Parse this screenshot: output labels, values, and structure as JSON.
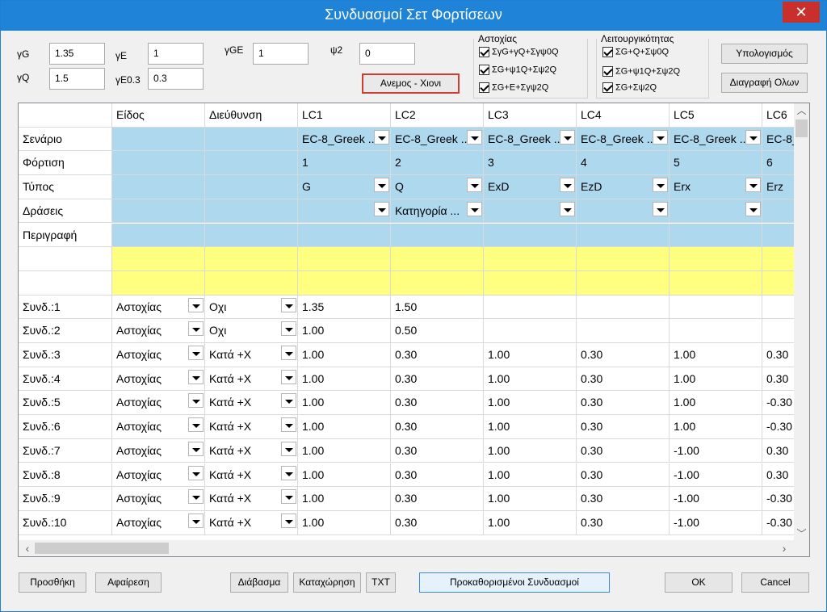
{
  "window": {
    "title": "Συνδυασμοί Σετ Φορτίσεων",
    "close": "✕"
  },
  "factors": {
    "gG": {
      "label": "γG",
      "value": "1.35"
    },
    "gQ": {
      "label": "γQ",
      "value": "1.5"
    },
    "gE": {
      "label": "γE",
      "value": "1"
    },
    "gE03": {
      "label": "γE0.3",
      "value": "0.3"
    },
    "gGE": {
      "label": "γGE",
      "value": "1"
    },
    "psi2": {
      "label": "ψ2",
      "value": "0"
    }
  },
  "wind_snow_button": "Ανεμος - Χιονι",
  "groups": {
    "failure": {
      "title": "Αστοχίας",
      "items": [
        "ΣγG+γQ+Σγψ0Q",
        "ΣG+ψ1Q+Σψ2Q",
        "ΣG+E+Σγψ2Q"
      ]
    },
    "service": {
      "title": "Λειτουργικότητας",
      "items": [
        "ΣG+Q+Σψ0Q",
        "ΣG+ψ1Q+Σψ2Q",
        "ΣG+Σψ2Q"
      ]
    }
  },
  "buttons": {
    "calculate": "Υπολογισμός",
    "delete_all": "Διαγραφή Ολων",
    "add": "Προσθήκη",
    "remove": "Αφαίρεση",
    "read": "Διάβασμα",
    "save": "Καταχώρηση",
    "txt": "TXT",
    "predefined": "Προκαθορισμένοι Συνδυασμοί",
    "ok": "OK",
    "cancel": "Cancel"
  },
  "grid": {
    "columns": [
      "",
      "Είδος",
      "Διεύθυνση",
      "LC1",
      "LC2",
      "LC3",
      "LC4",
      "LC5",
      "LC6"
    ],
    "meta_rows": [
      {
        "label": "Σενάριο",
        "cells": [
          "EC-8_Greek ...",
          "EC-8_Greek ...",
          "EC-8_Greek ...",
          "EC-8_Greek ...",
          "EC-8_Greek ...",
          "EC-8_"
        ]
      },
      {
        "label": "Φόρτιση",
        "cells": [
          "1",
          "2",
          "3",
          "4",
          "5",
          "6"
        ]
      },
      {
        "label": "Τύπος",
        "cells": [
          "G",
          "Q",
          "ExD",
          "EzD",
          "Erx",
          "Erz"
        ]
      },
      {
        "label": "Δράσεις",
        "cells": [
          "",
          "Κατηγορία ...",
          "",
          "",
          "",
          ""
        ]
      },
      {
        "label": "Περιγραφή",
        "cells": [
          "",
          "",
          "",
          "",
          "",
          ""
        ]
      }
    ],
    "combos": [
      {
        "label": "Συνδ.:1",
        "type": "Αστοχίας",
        "dir": "Οχι",
        "vals": [
          "1.35",
          "1.50",
          "",
          "",
          "",
          ""
        ]
      },
      {
        "label": "Συνδ.:2",
        "type": "Αστοχίας",
        "dir": "Οχι",
        "vals": [
          "1.00",
          "0.50",
          "",
          "",
          "",
          ""
        ]
      },
      {
        "label": "Συνδ.:3",
        "type": "Αστοχίας",
        "dir": "Κατά +X",
        "vals": [
          "1.00",
          "0.30",
          "1.00",
          "0.30",
          "1.00",
          "0.30"
        ]
      },
      {
        "label": "Συνδ.:4",
        "type": "Αστοχίας",
        "dir": "Κατά +X",
        "vals": [
          "1.00",
          "0.30",
          "1.00",
          "0.30",
          "1.00",
          "0.30"
        ]
      },
      {
        "label": "Συνδ.:5",
        "type": "Αστοχίας",
        "dir": "Κατά +X",
        "vals": [
          "1.00",
          "0.30",
          "1.00",
          "0.30",
          "1.00",
          "-0.30"
        ]
      },
      {
        "label": "Συνδ.:6",
        "type": "Αστοχίας",
        "dir": "Κατά +X",
        "vals": [
          "1.00",
          "0.30",
          "1.00",
          "0.30",
          "1.00",
          "-0.30"
        ]
      },
      {
        "label": "Συνδ.:7",
        "type": "Αστοχίας",
        "dir": "Κατά +X",
        "vals": [
          "1.00",
          "0.30",
          "1.00",
          "0.30",
          "-1.00",
          "0.30"
        ]
      },
      {
        "label": "Συνδ.:8",
        "type": "Αστοχίας",
        "dir": "Κατά +X",
        "vals": [
          "1.00",
          "0.30",
          "1.00",
          "0.30",
          "-1.00",
          "0.30"
        ]
      },
      {
        "label": "Συνδ.:9",
        "type": "Αστοχίας",
        "dir": "Κατά +X",
        "vals": [
          "1.00",
          "0.30",
          "1.00",
          "0.30",
          "-1.00",
          "-0.30"
        ]
      },
      {
        "label": "Συνδ.:10",
        "type": "Αστοχίας",
        "dir": "Κατά +X",
        "vals": [
          "1.00",
          "0.30",
          "1.00",
          "0.30",
          "-1.00",
          "-0.30"
        ]
      }
    ]
  }
}
